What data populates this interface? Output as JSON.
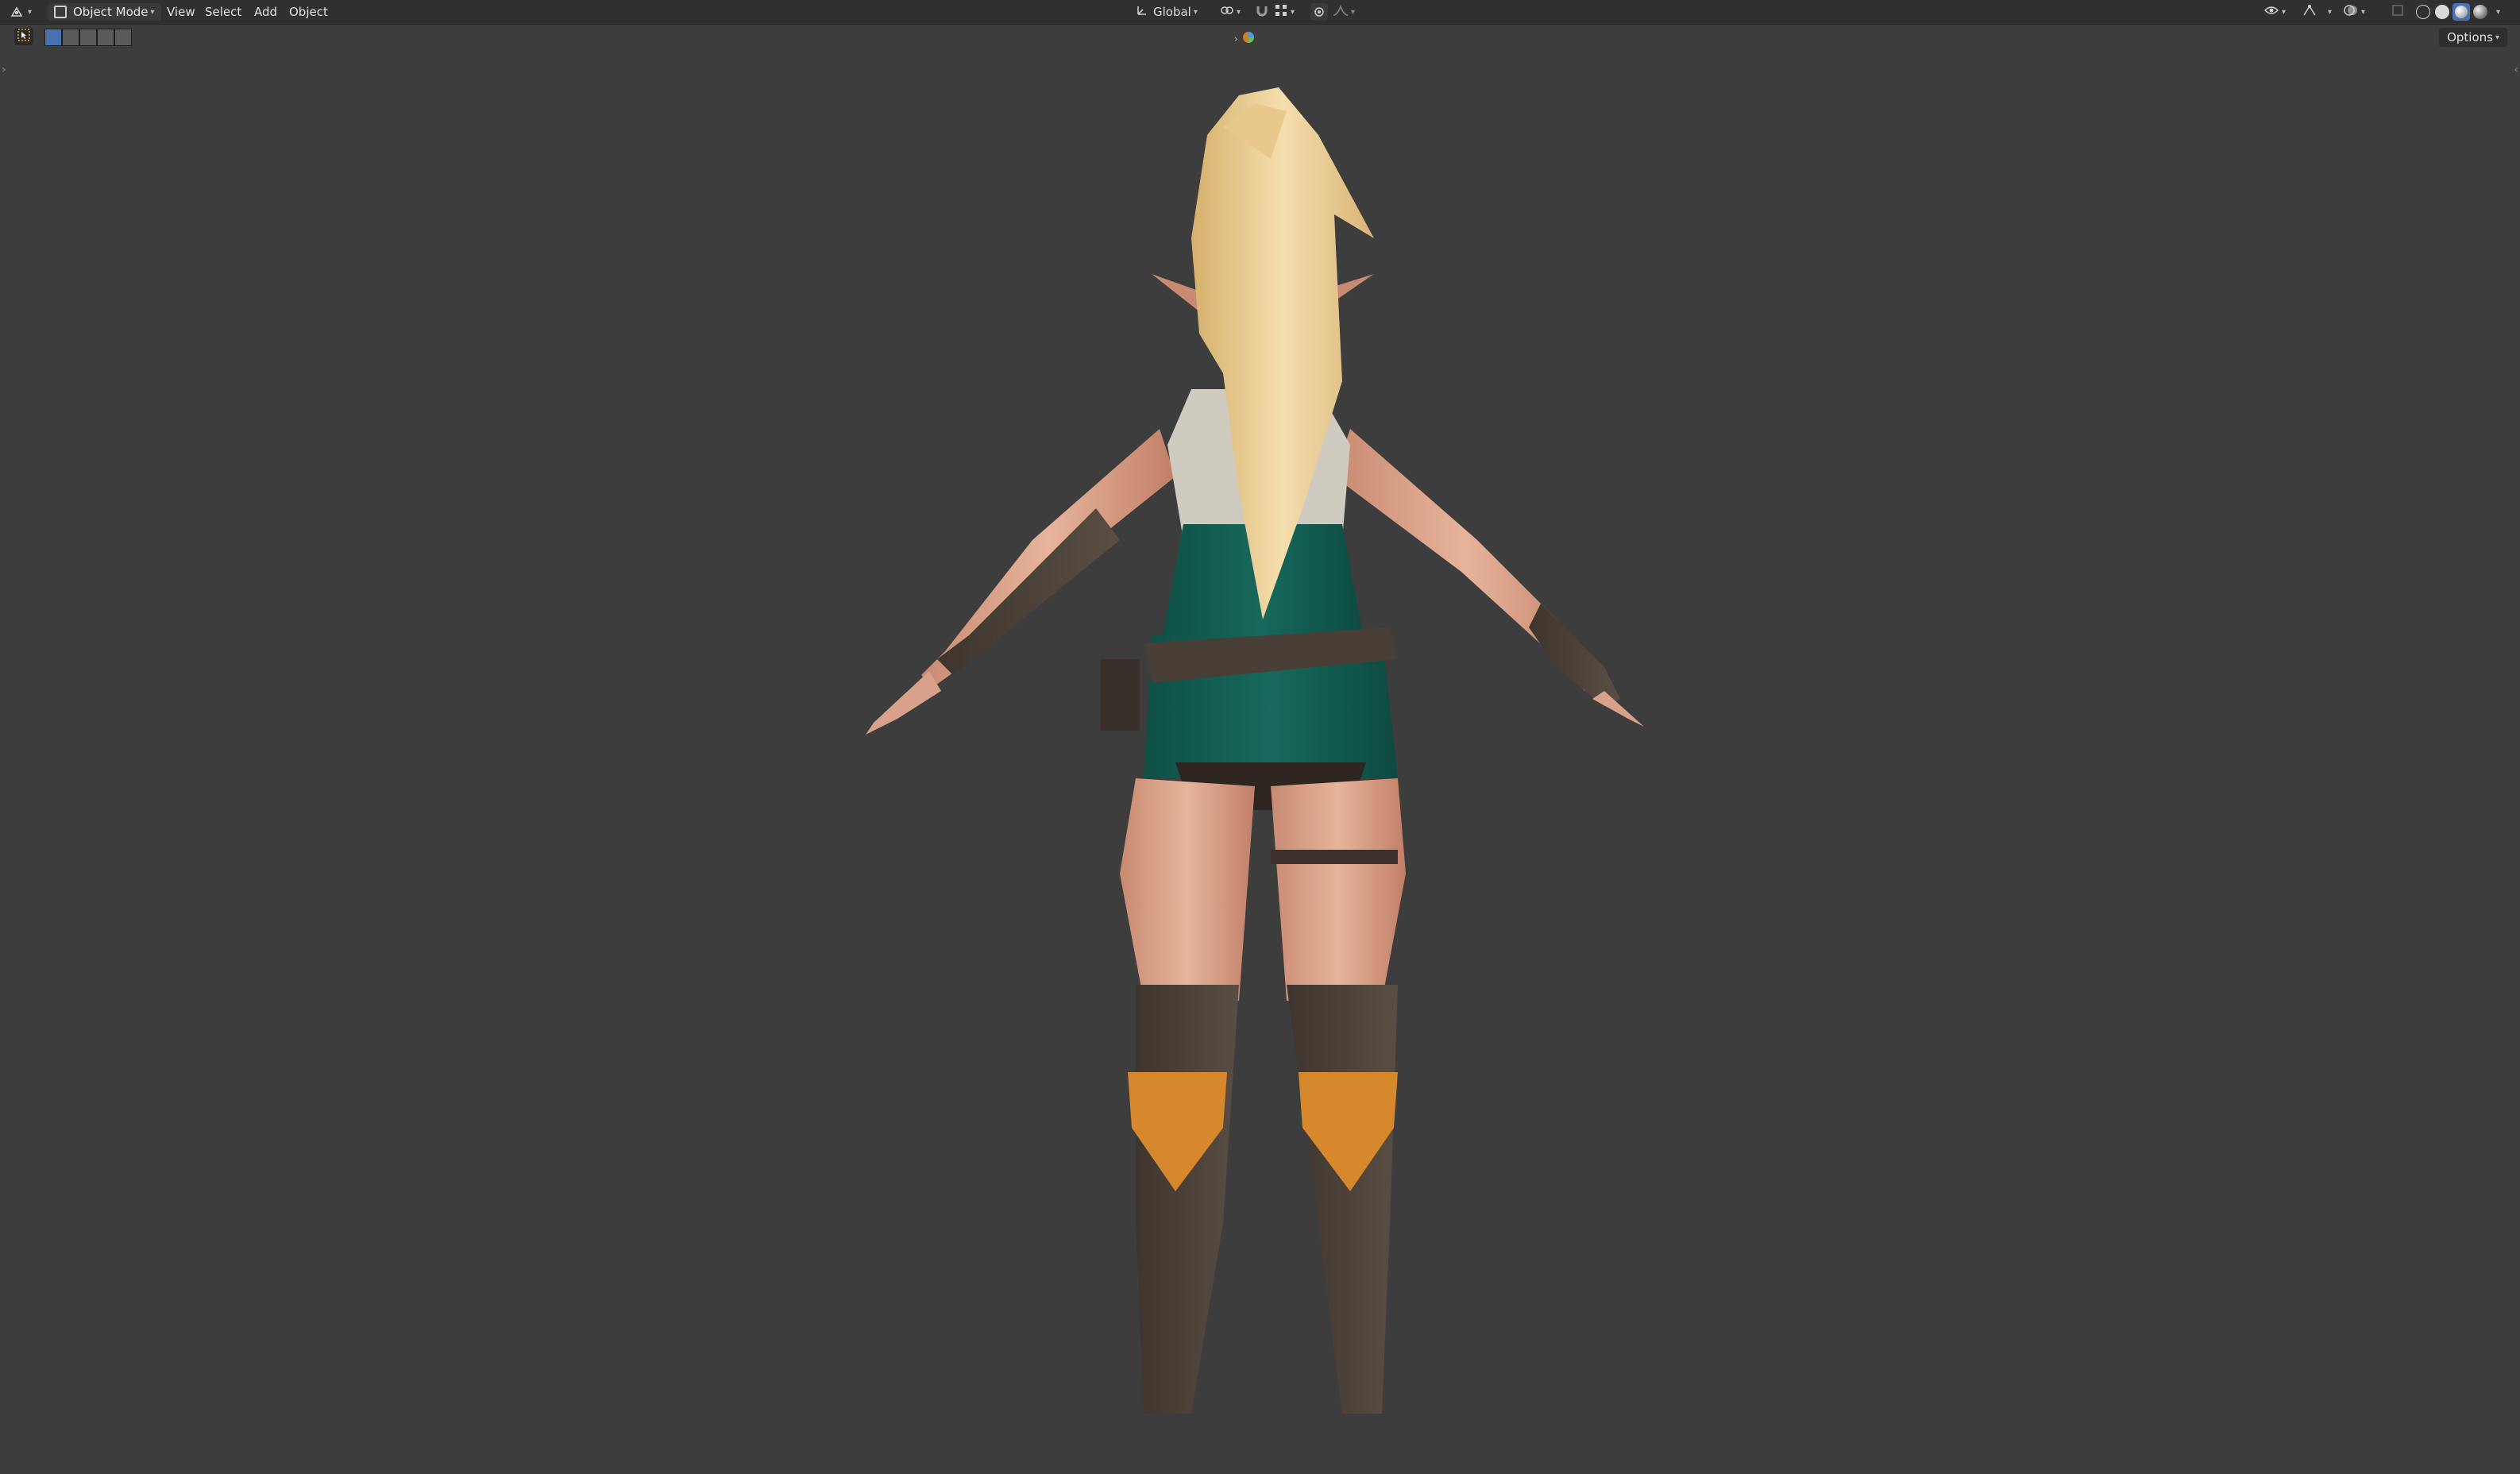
{
  "header": {
    "editor_type_icon": "editor-type-icon",
    "mode_label": "Object Mode",
    "menus": [
      "View",
      "Select",
      "Add",
      "Object"
    ],
    "transform_orientation": "Global",
    "pivot_icon": "link-icon",
    "snap_icon": "magnet-icon",
    "proportional_icon": "proportional-edit-icon",
    "right_tools": [
      "visibility-icon",
      "gizmo-icon",
      "overlay-icon",
      "xray-icon"
    ],
    "shading_modes": [
      "wireframe",
      "solid",
      "material-preview",
      "rendered"
    ],
    "active_shading": "material-preview"
  },
  "subheader": {
    "tools": [
      "select-box-icon",
      "select-new-icon",
      "select-extend-icon",
      "select-subtract-icon",
      "select-invert-icon",
      "select-intersect-icon"
    ],
    "center_icons": [
      "chevron-right-icon",
      "collection-icon"
    ],
    "options_label": "Options"
  },
  "colors": {
    "viewport_bg": "#3d3d3d",
    "header_bg": "#303030",
    "accent_blue": "#4772b3",
    "tool_active": "#f5a623"
  }
}
